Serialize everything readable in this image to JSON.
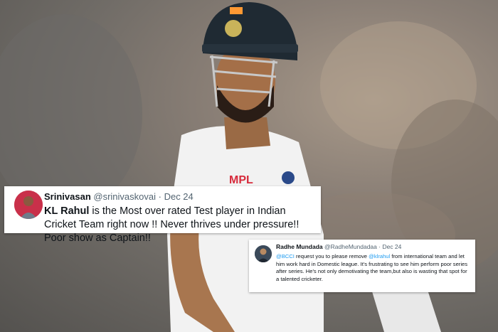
{
  "tweets": [
    {
      "name": "Srinivasan",
      "handle": "@srinivaskovai",
      "separator": " · ",
      "date": "Dec 24",
      "body_bold": "KL Rahul",
      "body_rest": " is the Most over rated Test player in Indian Cricket Team right now !! Never thrives under pressure!! Poor show as Captain!!"
    },
    {
      "name": "Radhe Mundada",
      "handle": "@RadheMundadaa",
      "separator": " · ",
      "date": "Dec 24",
      "mention_1": "@BCCI",
      "body_part_1": " request you to please remove ",
      "mention_2": "@klrahul",
      "body_part_2": " from international team and let him work hard in Domestic league. It's frustrating to see him perform poor series after series. He's not only demotivating the team,but also is wasting that spot for a talented cricketer."
    }
  ],
  "photo": {
    "shirt_logo_text": "MPL"
  },
  "colors": {
    "mention": "#1d9bf0",
    "text": "#0f1419",
    "muted": "#536471",
    "helmet": "#1f2a33",
    "shirt": "#f4f4f4"
  }
}
